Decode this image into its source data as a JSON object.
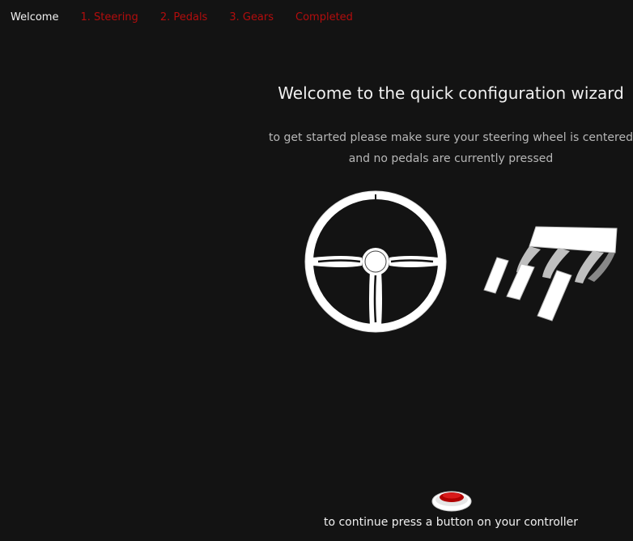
{
  "tabs": [
    {
      "label": "Welcome",
      "state": "active"
    },
    {
      "label": "1. Steering",
      "state": "inactive"
    },
    {
      "label": "2. Pedals",
      "state": "inactive"
    },
    {
      "label": "3. Gears",
      "state": "inactive"
    },
    {
      "label": "Completed",
      "state": "inactive"
    }
  ],
  "content": {
    "title": "Welcome to the quick configuration wizard",
    "subtitle": "to get started please make sure your steering wheel is centered and no pedals are currently pressed",
    "footer": "to continue press a button on your controller"
  },
  "icons": {
    "wheel": "steering-wheel-icon",
    "pedals": "pedals-icon",
    "button": "controller-button-icon"
  },
  "colors": {
    "background": "#131313",
    "active_tab": "#f2f2f2",
    "inactive_tab": "#b30d0d",
    "button_red": "#b00000"
  }
}
